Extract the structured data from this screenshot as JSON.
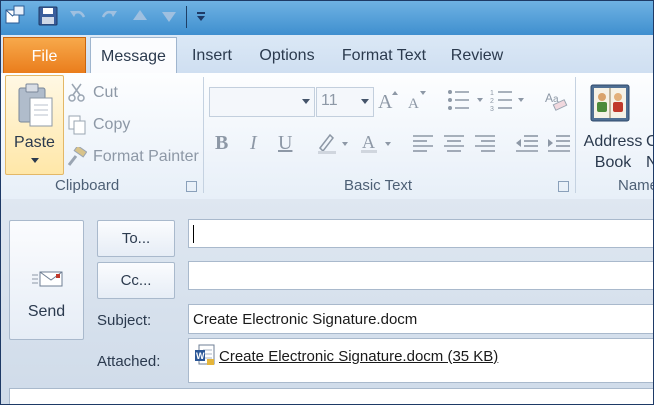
{
  "ribbon_tabs": {
    "file": "File",
    "message": "Message",
    "insert": "Insert",
    "options": "Options",
    "format_text": "Format Text",
    "review": "Review"
  },
  "clipboard": {
    "paste": "Paste",
    "cut": "Cut",
    "copy": "Copy",
    "format_painter": "Format Painter",
    "group_label": "Clipboard"
  },
  "basic_text": {
    "font_name": "",
    "font_size": "11",
    "bold": "B",
    "italic": "I",
    "underline": "U",
    "font_color": "A",
    "group_label": "Basic Text"
  },
  "names": {
    "address_book_line1": "Address",
    "address_book_line2": "Book",
    "check_names_line1": "C",
    "check_names_line2": "N",
    "group_label_partial": "Name"
  },
  "compose": {
    "send": "Send",
    "to_button": "To...",
    "cc_button": "Cc...",
    "subject_label": "Subject:",
    "subject_value": "Create Electronic Signature.docm",
    "attached_label": "Attached:",
    "attachment": "Create Electronic Signature.docm (35 KB)"
  },
  "colors": {
    "title_bar": "#3f8fcf",
    "file_tab": "#ea7d1c",
    "ribbon": "#fdfeff",
    "compose_bg": "#dfe7f1"
  }
}
